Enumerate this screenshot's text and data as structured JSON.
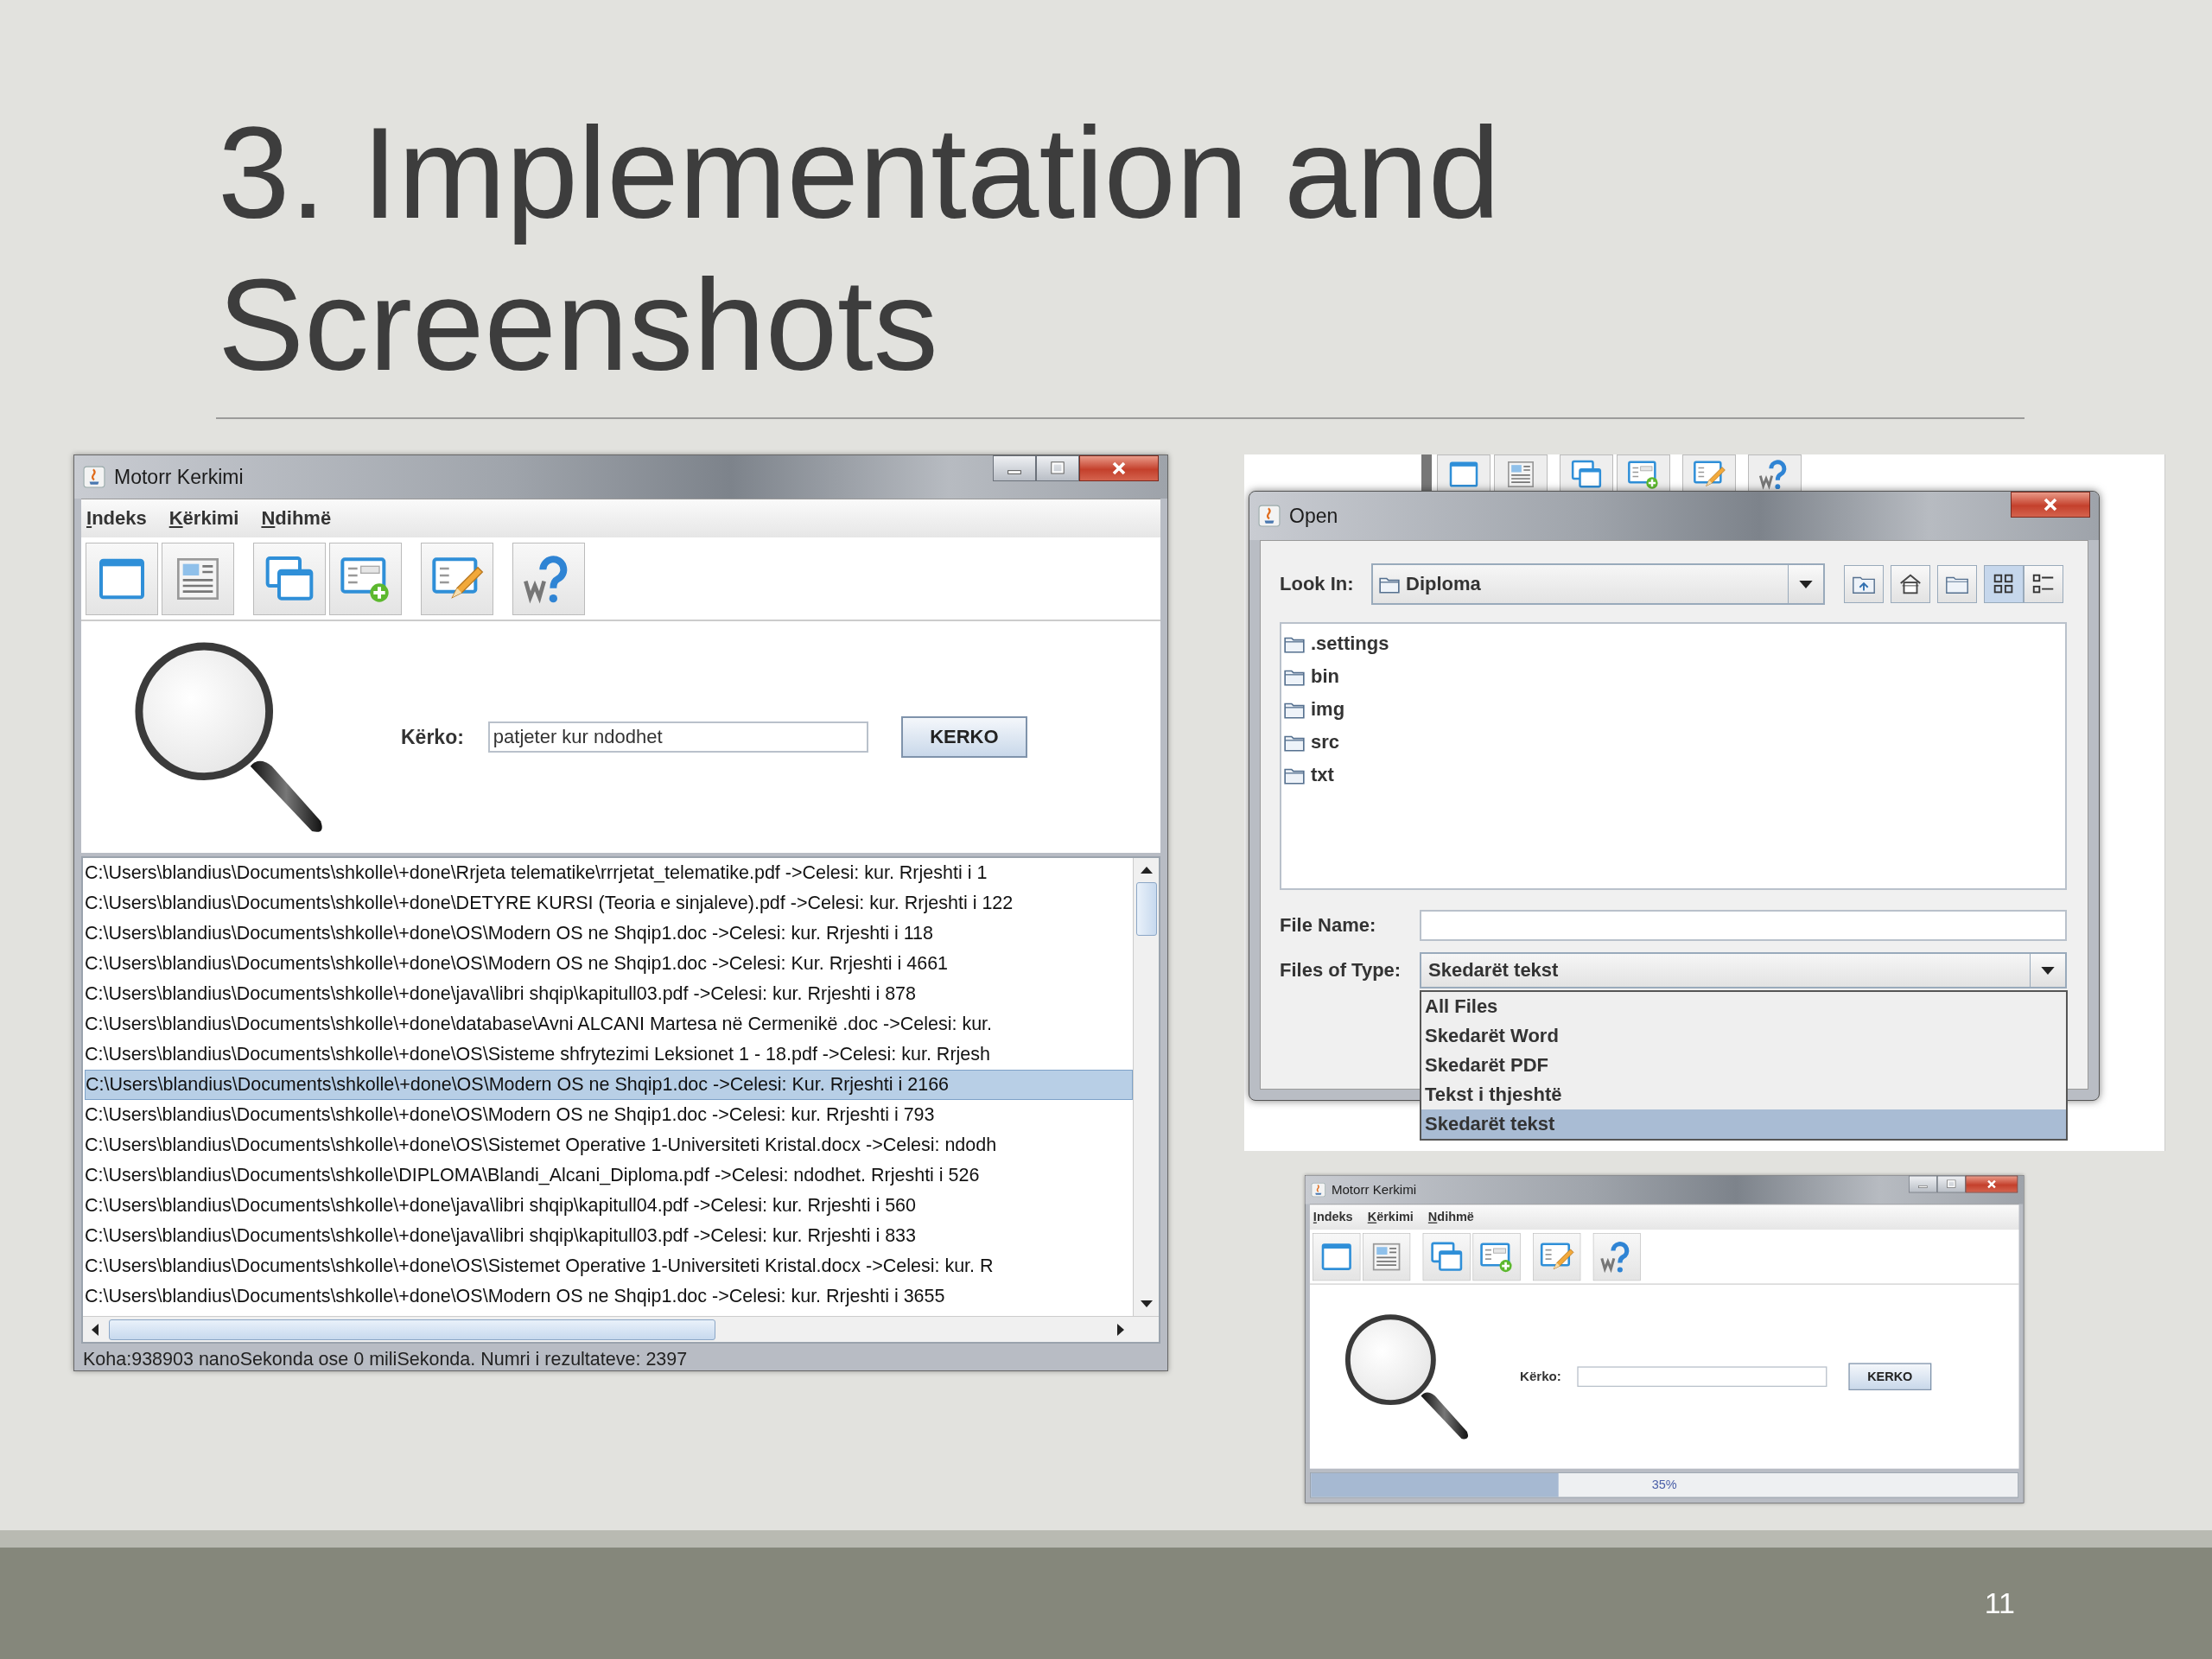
{
  "slide": {
    "title": "3. Implementation and Screenshots",
    "page_number": "11"
  },
  "main_window": {
    "title": "Motorr Kerkimi",
    "menu": [
      "Indeks",
      "Kërkimi",
      "Ndihmë"
    ],
    "search_label": "Kërko:",
    "search_value": "patjeter kur ndodhet",
    "search_button": "KERKO",
    "results": [
      {
        "text": "C:\\Users\\blandius\\Documents\\shkolle\\+done\\Rrjeta telematike\\rrrjetat_telematike.pdf ->Celesi: kur. Rrjeshti i 1",
        "selected": false
      },
      {
        "text": "C:\\Users\\blandius\\Documents\\shkolle\\+done\\DETYRE KURSI (Teoria e sinjaleve).pdf ->Celesi: kur. Rrjeshti i 122",
        "selected": false
      },
      {
        "text": "C:\\Users\\blandius\\Documents\\shkolle\\+done\\OS\\Modern OS ne Shqip1.doc ->Celesi: kur. Rrjeshti i 118",
        "selected": false
      },
      {
        "text": "C:\\Users\\blandius\\Documents\\shkolle\\+done\\OS\\Modern OS ne Shqip1.doc ->Celesi: Kur. Rrjeshti i 4661",
        "selected": false
      },
      {
        "text": "C:\\Users\\blandius\\Documents\\shkolle\\+done\\java\\libri shqip\\kapitull03.pdf ->Celesi: kur. Rrjeshti i 878",
        "selected": false
      },
      {
        "text": "C:\\Users\\blandius\\Documents\\shkolle\\+done\\database\\Avni ALCANI Martesa në Cermenikë .doc ->Celesi: kur.",
        "selected": false
      },
      {
        "text": "C:\\Users\\blandius\\Documents\\shkolle\\+done\\OS\\Sisteme shfrytezimi Leksionet 1 - 18.pdf ->Celesi: kur. Rrjesh",
        "selected": false
      },
      {
        "text": "C:\\Users\\blandius\\Documents\\shkolle\\+done\\OS\\Modern OS ne Shqip1.doc ->Celesi: Kur. Rrjeshti i 2166",
        "selected": true
      },
      {
        "text": "C:\\Users\\blandius\\Documents\\shkolle\\+done\\OS\\Modern OS ne Shqip1.doc ->Celesi: kur. Rrjeshti i 793",
        "selected": false
      },
      {
        "text": "C:\\Users\\blandius\\Documents\\shkolle\\+done\\OS\\Sistemet Operative 1-Universiteti Kristal.docx ->Celesi: ndodh",
        "selected": false
      },
      {
        "text": "C:\\Users\\blandius\\Documents\\shkolle\\DIPLOMA\\Blandi_Alcani_Diploma.pdf ->Celesi: ndodhet. Rrjeshti i 526",
        "selected": false
      },
      {
        "text": "C:\\Users\\blandius\\Documents\\shkolle\\+done\\java\\libri shqip\\kapitull04.pdf ->Celesi: kur. Rrjeshti i 560",
        "selected": false
      },
      {
        "text": "C:\\Users\\blandius\\Documents\\shkolle\\+done\\java\\libri shqip\\kapitull03.pdf ->Celesi: kur. Rrjeshti i 833",
        "selected": false
      },
      {
        "text": "C:\\Users\\blandius\\Documents\\shkolle\\+done\\OS\\Sistemet Operative 1-Universiteti Kristal.docx ->Celesi: kur. R",
        "selected": false
      },
      {
        "text": "C:\\Users\\blandius\\Documents\\shkolle\\+done\\OS\\Modern OS ne Shqip1.doc ->Celesi: kur. Rrjeshti i 3655",
        "selected": false
      }
    ],
    "status": "Koha:938903 nanoSekonda ose 0 miliSekonda. Numri i rezultateve: 2397"
  },
  "open_dialog": {
    "title": "Open",
    "look_in_label": "Look In:",
    "look_in_value": "Diploma",
    "files": [
      ".settings",
      "bin",
      "img",
      "src",
      "txt"
    ],
    "file_name_label": "File Name:",
    "file_type_label": "Files of Type:",
    "file_type_value": "Skedarët tekst",
    "file_type_options": [
      {
        "label": "All Files",
        "selected": false
      },
      {
        "label": "Skedarët Word",
        "selected": false
      },
      {
        "label": "Skedarët PDF",
        "selected": false
      },
      {
        "label": "Tekst i thjeshtë",
        "selected": false
      },
      {
        "label": "Skedarët tekst",
        "selected": true
      }
    ]
  },
  "progress_window": {
    "title": "Motorr Kerkimi",
    "menu": [
      "Indeks",
      "Kërkimi",
      "Ndihmë"
    ],
    "search_label": "Kërko:",
    "search_button": "KERKO",
    "progress": {
      "level": 0.35,
      "text": "35%"
    }
  }
}
